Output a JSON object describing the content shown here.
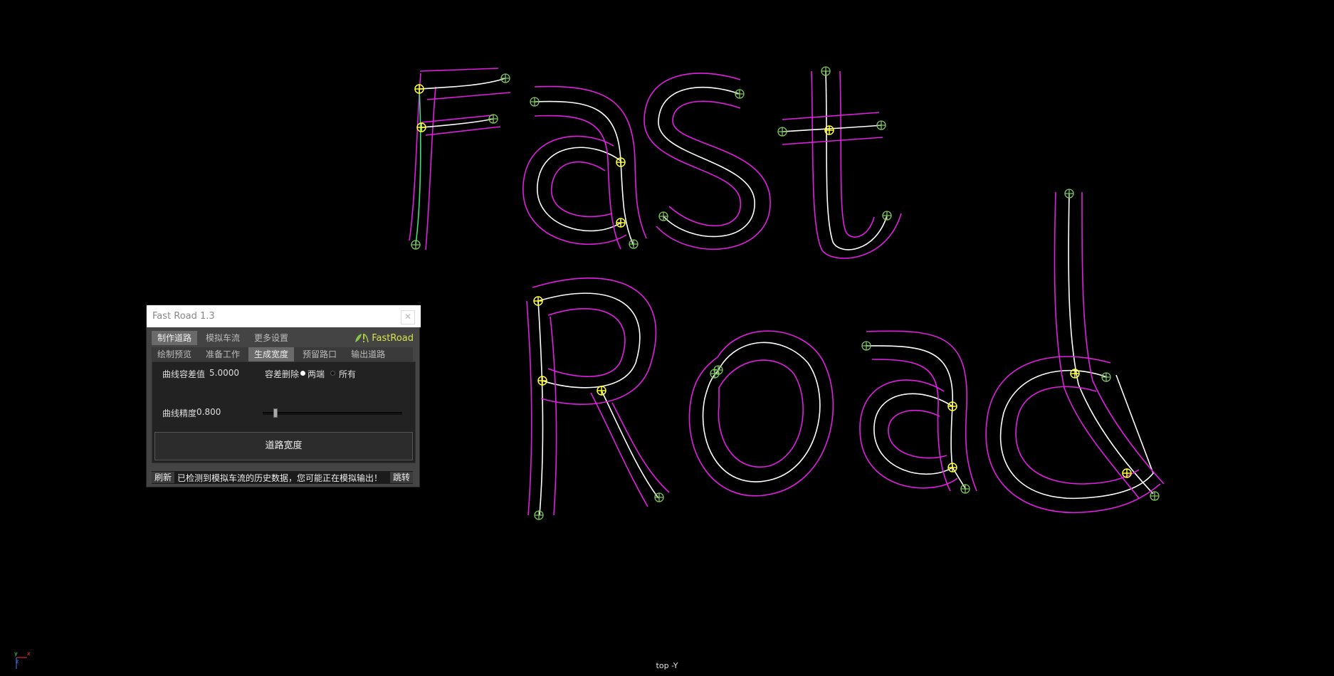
{
  "viewport": {
    "camera_label": "top -Y",
    "axis": {
      "y": "y",
      "x": "x",
      "z": "z"
    },
    "colors": {
      "background": "#000000",
      "road_center": "#ffffff",
      "road_edge": "#e11ee1",
      "selected_curve": "#3ee07a",
      "control_point": "#ffff33",
      "end_point": "#7cc65a"
    }
  },
  "panel": {
    "title": "Fast Road 1.3",
    "close_glyph": "✕",
    "brand": "FastRoad",
    "tabs": [
      "制作道路",
      "模拟车流",
      "更多设置"
    ],
    "active_tab": "制作道路",
    "subtabs": [
      "绘制预览",
      "准备工作",
      "生成宽度",
      "预留路口",
      "输出道路"
    ],
    "active_subtab": "生成宽度",
    "tolerance_label": "曲线容差值",
    "tolerance_value": "5.0000",
    "delete_label": "容差删除",
    "radio_both": "两端",
    "radio_all": "所有",
    "precision_label": "曲线精度",
    "precision_value": "0.800",
    "action_button": "道路宽度",
    "refresh_button": "刷新",
    "status_message": "已检测到模拟车流的历史数据，您可能正在模拟输出！",
    "jump_button": "跳转"
  }
}
